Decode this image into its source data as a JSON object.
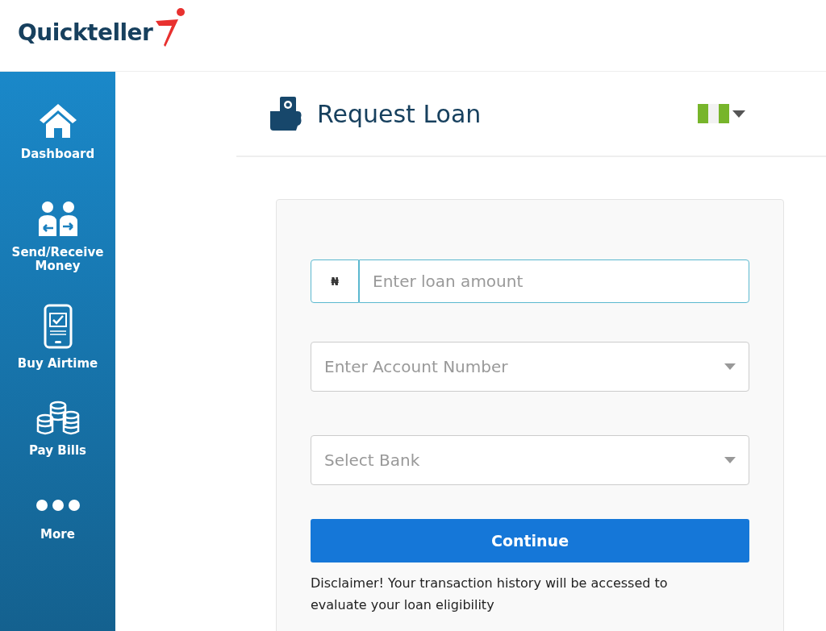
{
  "logo": {
    "text": "Quickteller"
  },
  "sidebar": {
    "items": [
      {
        "label": "Dashboard",
        "kind": "home"
      },
      {
        "label": "Send/Receive Money",
        "kind": "transfer"
      },
      {
        "label": "Buy Airtime",
        "kind": "phone"
      },
      {
        "label": "Pay Bills",
        "kind": "coins"
      },
      {
        "label": "More",
        "kind": "more"
      }
    ]
  },
  "page": {
    "title": "Request Loan"
  },
  "form": {
    "amount": {
      "currency": "₦",
      "placeholder": "Enter loan amount",
      "focused": true
    },
    "selects": [
      {
        "placeholder": "Enter Account Number"
      },
      {
        "placeholder": "Select Bank"
      }
    ],
    "submit": "Continue",
    "disclaimer": "Disclaimer! Your transaction history will be accessed to evaluate your loan eligibility"
  }
}
